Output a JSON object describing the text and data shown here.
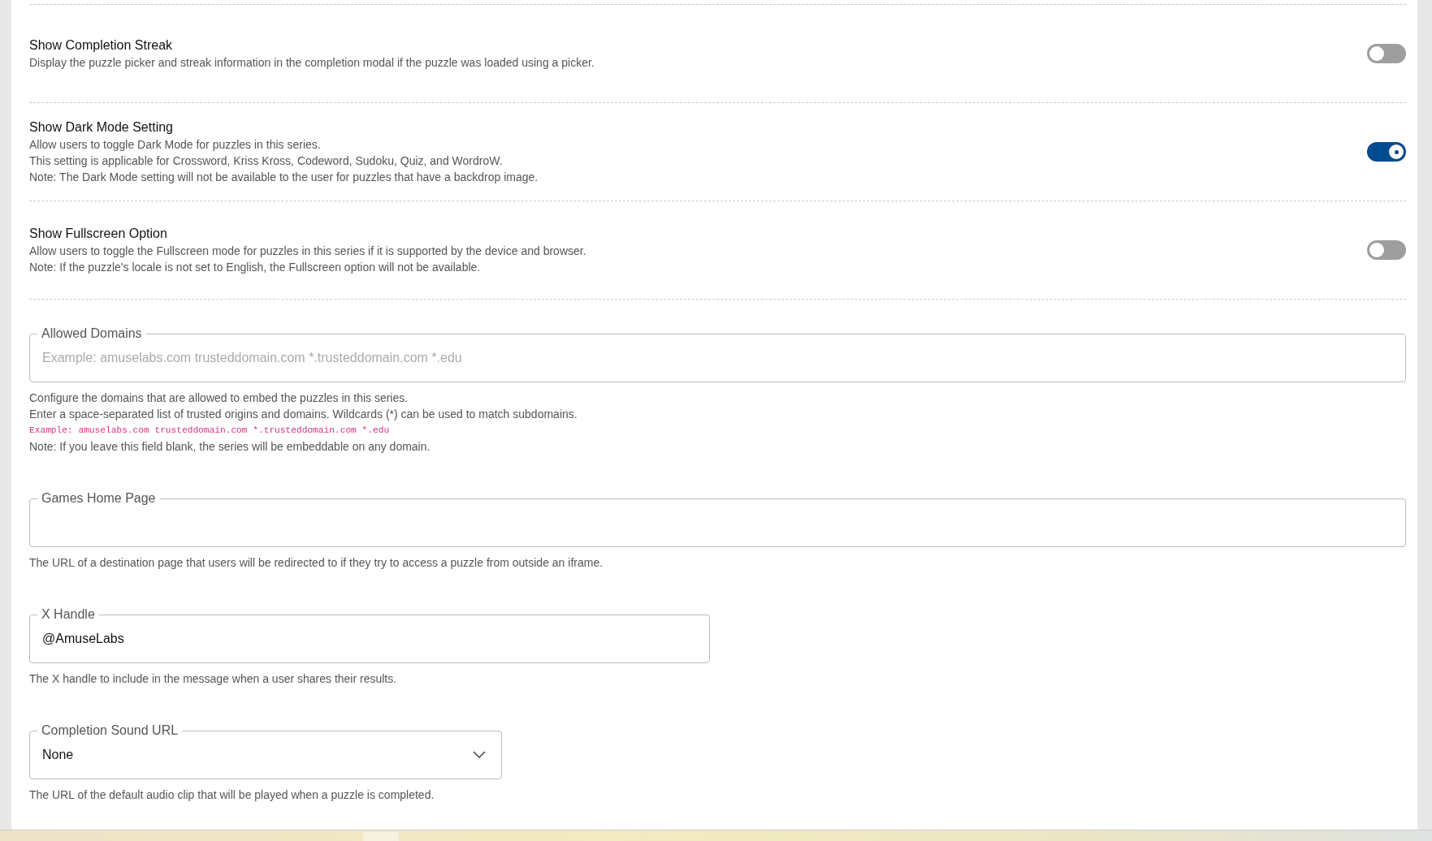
{
  "settings": [
    {
      "title": "Show Completion Streak",
      "description": [
        "Display the puzzle picker and streak information in the completion modal if the puzzle was loaded using a picker."
      ],
      "on": false
    },
    {
      "title": "Show Dark Mode Setting",
      "description": [
        "Allow users to toggle Dark Mode for puzzles in this series.",
        "This setting is applicable for Crossword, Kriss Kross, Codeword, Sudoku, Quiz, and WordroW.",
        "Note: The Dark Mode setting will not be available to the user for puzzles that have a backdrop image."
      ],
      "on": true
    },
    {
      "title": "Show Fullscreen Option",
      "description": [
        "Allow users to toggle the Fullscreen mode for puzzles in this series if it is supported by the device and browser.",
        "Note: If the puzzle's locale is not set to English, the Fullscreen option will not be available."
      ],
      "on": false
    }
  ],
  "fields": [
    {
      "kind": "text",
      "label": "Allowed Domains",
      "placeholder": "Example: amuselabs.com trusteddomain.com *.trusteddomain.com *.edu",
      "help": [
        {
          "kind": "text",
          "text": "Configure the domains that are allowed to embed the puzzles in this series."
        },
        {
          "kind": "text",
          "text": "Enter a space-separated list of trusted origins and domains. Wildcards (*) can be used to match subdomains."
        },
        {
          "kind": "code",
          "text": "Example: amuselabs.com trusteddomain.com *.trusteddomain.com *.edu"
        },
        {
          "kind": "text",
          "text": "Note: If you leave this field blank, the series will be embeddable on any domain."
        }
      ]
    },
    {
      "kind": "text",
      "label": "Games Home Page",
      "help": [
        {
          "kind": "text",
          "text": "The URL of a destination page that users will be redirected to if they try to access a puzzle from outside an iframe."
        }
      ]
    },
    {
      "kind": "text",
      "label": "X Handle",
      "value": "@AmuseLabs",
      "help": [
        {
          "kind": "text",
          "text": "The X handle to include in the message when a user shares their results."
        }
      ]
    },
    {
      "kind": "select",
      "label": "Completion Sound URL",
      "value": "None",
      "help": [
        {
          "kind": "text",
          "text": "The URL of the default audio clip that will be played when a puzzle is completed."
        }
      ]
    }
  ]
}
